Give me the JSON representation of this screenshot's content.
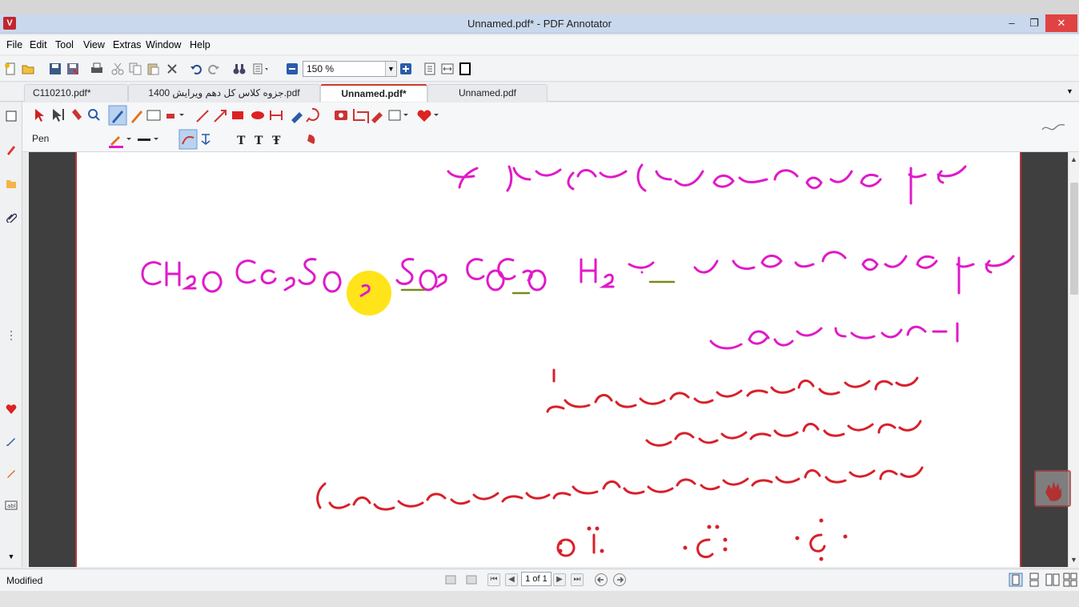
{
  "window": {
    "title": "Unnamed.pdf* - PDF Annotator",
    "app_icon_glyph": "V",
    "minimize": "–",
    "maximize": "❐",
    "close": "✕"
  },
  "menu": {
    "items": [
      "File",
      "Edit",
      "Tool",
      "View",
      "Extras",
      "Window",
      "Help"
    ]
  },
  "toolbar": {
    "zoom_value": "150 %"
  },
  "tabs": [
    {
      "label": "C110210.pdf*",
      "active": false
    },
    {
      "label": "جزوه کلاس کل دهم ویرایش 1400.pdf",
      "active": false
    },
    {
      "label": "Unnamed.pdf*",
      "active": true
    },
    {
      "label": "Unnamed.pdf",
      "active": false
    }
  ],
  "tool_panel": {
    "current_tool": "Pen"
  },
  "page": {
    "ink_color_primary": "#e01ac8",
    "ink_color_secondary": "#d8202a",
    "ink_color_underline": "#7a8a1a",
    "highlight_color": "#ffe100"
  },
  "navigation": {
    "page_indicator": "1 of 1"
  },
  "status": {
    "text": "Modified"
  }
}
